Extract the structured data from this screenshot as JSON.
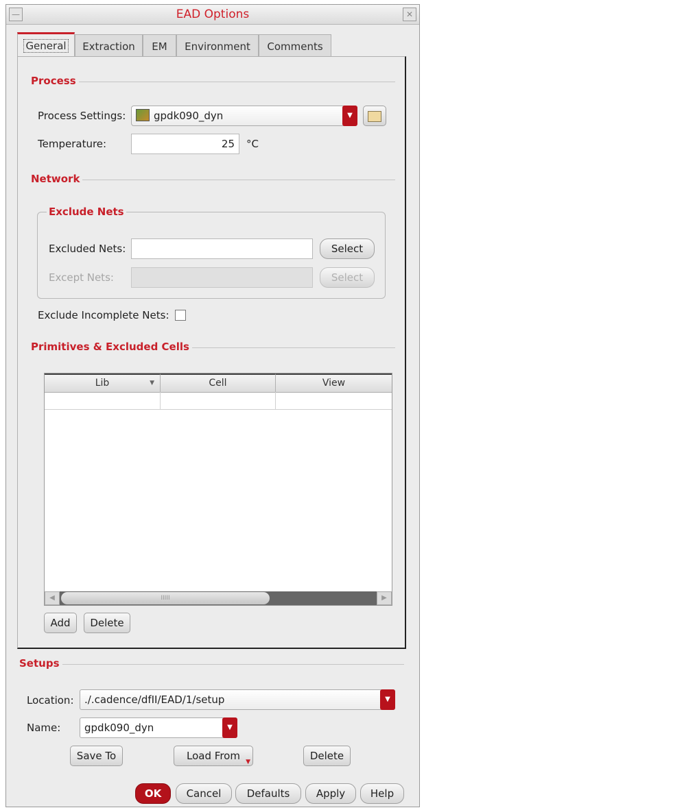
{
  "window": {
    "title": "EAD Options"
  },
  "tabs": [
    "General",
    "Extraction",
    "EM",
    "Environment",
    "Comments"
  ],
  "process": {
    "header": "Process",
    "settings_label": "Process Settings:",
    "settings_value": "gpdk090_dyn",
    "temperature_label": "Temperature:",
    "temperature_value": "25",
    "temperature_unit": "°C"
  },
  "network": {
    "header": "Network",
    "exclude_nets": {
      "header": "Exclude Nets",
      "excluded_label": "Excluded Nets:",
      "excluded_value": "",
      "except_label": "Except Nets:",
      "except_value": "",
      "select_label": "Select"
    },
    "exclude_incomplete_label": "Exclude Incomplete Nets:"
  },
  "primitives": {
    "header": "Primitives & Excluded Cells",
    "columns": [
      "Lib",
      "Cell",
      "View"
    ],
    "add_label": "Add",
    "delete_label": "Delete"
  },
  "setups": {
    "header": "Setups",
    "location_label": "Location:",
    "location_value": "./.cadence/dfII/EAD/1/setup",
    "name_label": "Name:",
    "name_value": "gpdk090_dyn",
    "save_to_label": "Save To",
    "load_from_label": "Load From",
    "delete_label": "Delete"
  },
  "footer": {
    "ok": "OK",
    "cancel": "Cancel",
    "defaults": "Defaults",
    "apply": "Apply",
    "help": "Help"
  },
  "colors": {
    "accent": "#c8202a",
    "ok_button": "#b3121b"
  }
}
